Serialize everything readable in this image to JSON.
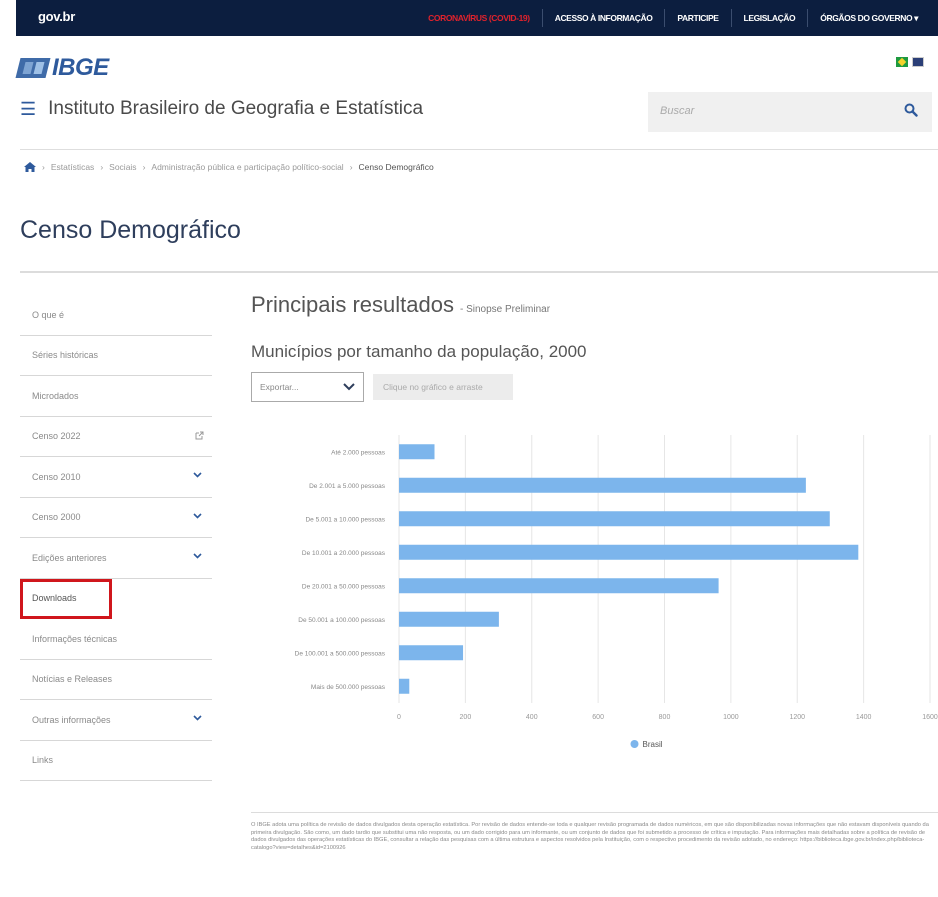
{
  "govbar": {
    "logo": "gov.br",
    "links": [
      "CORONAVÍRUS (COVID-19)",
      "ACESSO À INFORMAÇÃO",
      "PARTICIPE",
      "LEGISLAÇÃO",
      "ÓRGÃOS DO GOVERNO ▾"
    ]
  },
  "header": {
    "logo": "IBGE",
    "institute": "Instituto Brasileiro de Geografia e Estatística",
    "search_placeholder": "Buscar"
  },
  "breadcrumb": [
    "Estatísticas",
    "Sociais",
    "Administração pública e participação político-social",
    "Censo Demográfico"
  ],
  "page_title": "Censo Demográfico",
  "sidebar": {
    "items": [
      {
        "label": "O que é"
      },
      {
        "label": "Séries históricas"
      },
      {
        "label": "Microdados"
      },
      {
        "label": "Censo 2022"
      },
      {
        "label": "Censo 2010"
      },
      {
        "label": "Censo 2000"
      },
      {
        "label": "Edições anteriores"
      },
      {
        "label": "Downloads"
      },
      {
        "label": "Informações técnicas"
      },
      {
        "label": "Notícias e Releases"
      },
      {
        "label": "Outras informações"
      },
      {
        "label": "Links"
      }
    ]
  },
  "main": {
    "heading": "Principais resultados",
    "subheading": "- Sinopse Preliminar",
    "chart_title": "Municípios por tamanho da população, 2000",
    "export_label": "Exportar...",
    "hint": "Clique no gráfico e arraste"
  },
  "chart_data": {
    "type": "bar",
    "orientation": "horizontal",
    "categories": [
      "Até 2.000 pessoas",
      "De 2.001 a 5.000 pessoas",
      "De 5.001 a 10.000 pessoas",
      "De 10.001 a 20.000 pessoas",
      "De 20.001 a 50.000 pessoas",
      "De 50.001 a 100.000 pessoas",
      "De 100.001 a 500.000 pessoas",
      "Mais de 500.000 pessoas"
    ],
    "series": [
      {
        "name": "Brasil",
        "values": [
          107,
          1226,
          1298,
          1384,
          963,
          301,
          193,
          31
        ]
      }
    ],
    "xlim": [
      0,
      1600
    ],
    "xticks": [
      "0",
      "200",
      "400",
      "600",
      "800",
      "1000",
      "1200",
      "1400",
      "1600"
    ],
    "grid": true,
    "legend": "bottom",
    "color": "#7cb5ec"
  },
  "footnote": "O IBGE adota uma política de revisão de dados divulgados desta operação estatística. Por revisão de dados entende-se toda e qualquer revisão programada de dados numéricos, em que são disponibilizadas novas informações que não estavam disponíveis quando da primeira divulgação. São como, um dado tardio que substitui uma não resposta, ou um dado corrigido para um informante, ou um conjunto de dados que foi submetido a processo de crítica e imputação. Para informações mais detalhadas sobre a política de revisão de dados divulgados das operações estatísticas do IBGE, consultar a relação das pesquisas com a última estrutura e aspectos resolvidos pela Instituição, com o respectivo procedimento da revisão adotado, no endereço: https://biblioteca.ibge.gov.br/index.php/biblioteca-catalogo?view=detalhes&id=2100926"
}
